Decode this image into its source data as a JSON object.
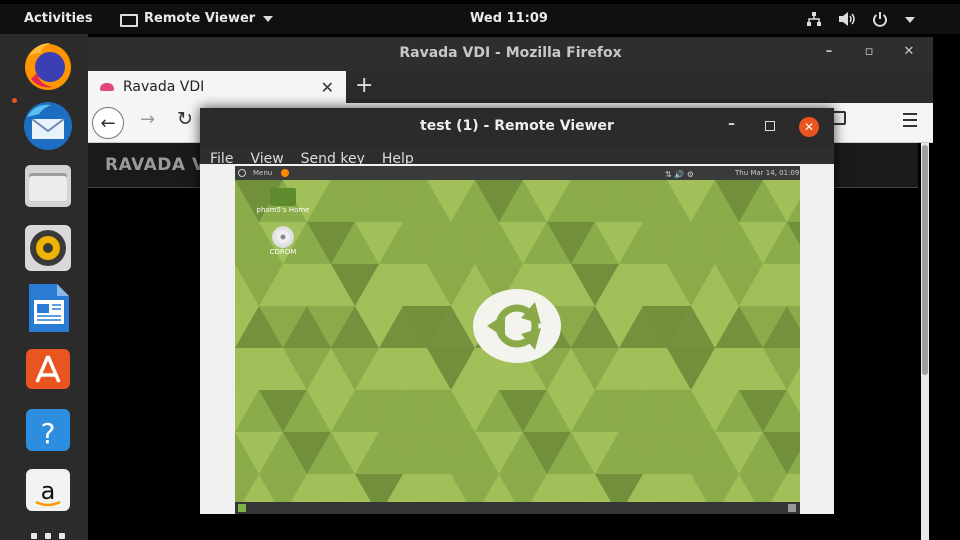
{
  "topbar": {
    "activities": "Activities",
    "app_menu": "Remote Viewer",
    "clock": "Wed 11:09",
    "tray_icons": [
      "network-icon",
      "volume-icon",
      "power-icon",
      "chevron-down-icon"
    ]
  },
  "dock": {
    "items": [
      "firefox-icon",
      "thunderbird-icon",
      "files-icon",
      "rhythmbox-icon",
      "writer-icon",
      "software-icon",
      "help-icon",
      "amazon-icon"
    ],
    "show_apps": "show-applications-icon"
  },
  "firefox": {
    "title": "Ravada VDI - Mozilla Firefox",
    "tab_label": "Ravada VDI",
    "page_heading": "RAVADA V"
  },
  "remote_viewer": {
    "title": "test (1) - Remote Viewer",
    "menu": [
      "File",
      "View",
      "Send key",
      "Help"
    ],
    "close_glyph": "✕"
  },
  "guest": {
    "panel_menu": "Menu",
    "panel_clock": "Thu Mar 14, 01:09",
    "icons": [
      "phom5's Home",
      "CDROM"
    ],
    "colors": {
      "light": "#a2c15a",
      "mid": "#8aaa4a",
      "dark": "#6e8c3a"
    }
  },
  "colors": {
    "accent": "#e95420",
    "topbar": "#101010",
    "dock": "#2b2b2b"
  }
}
